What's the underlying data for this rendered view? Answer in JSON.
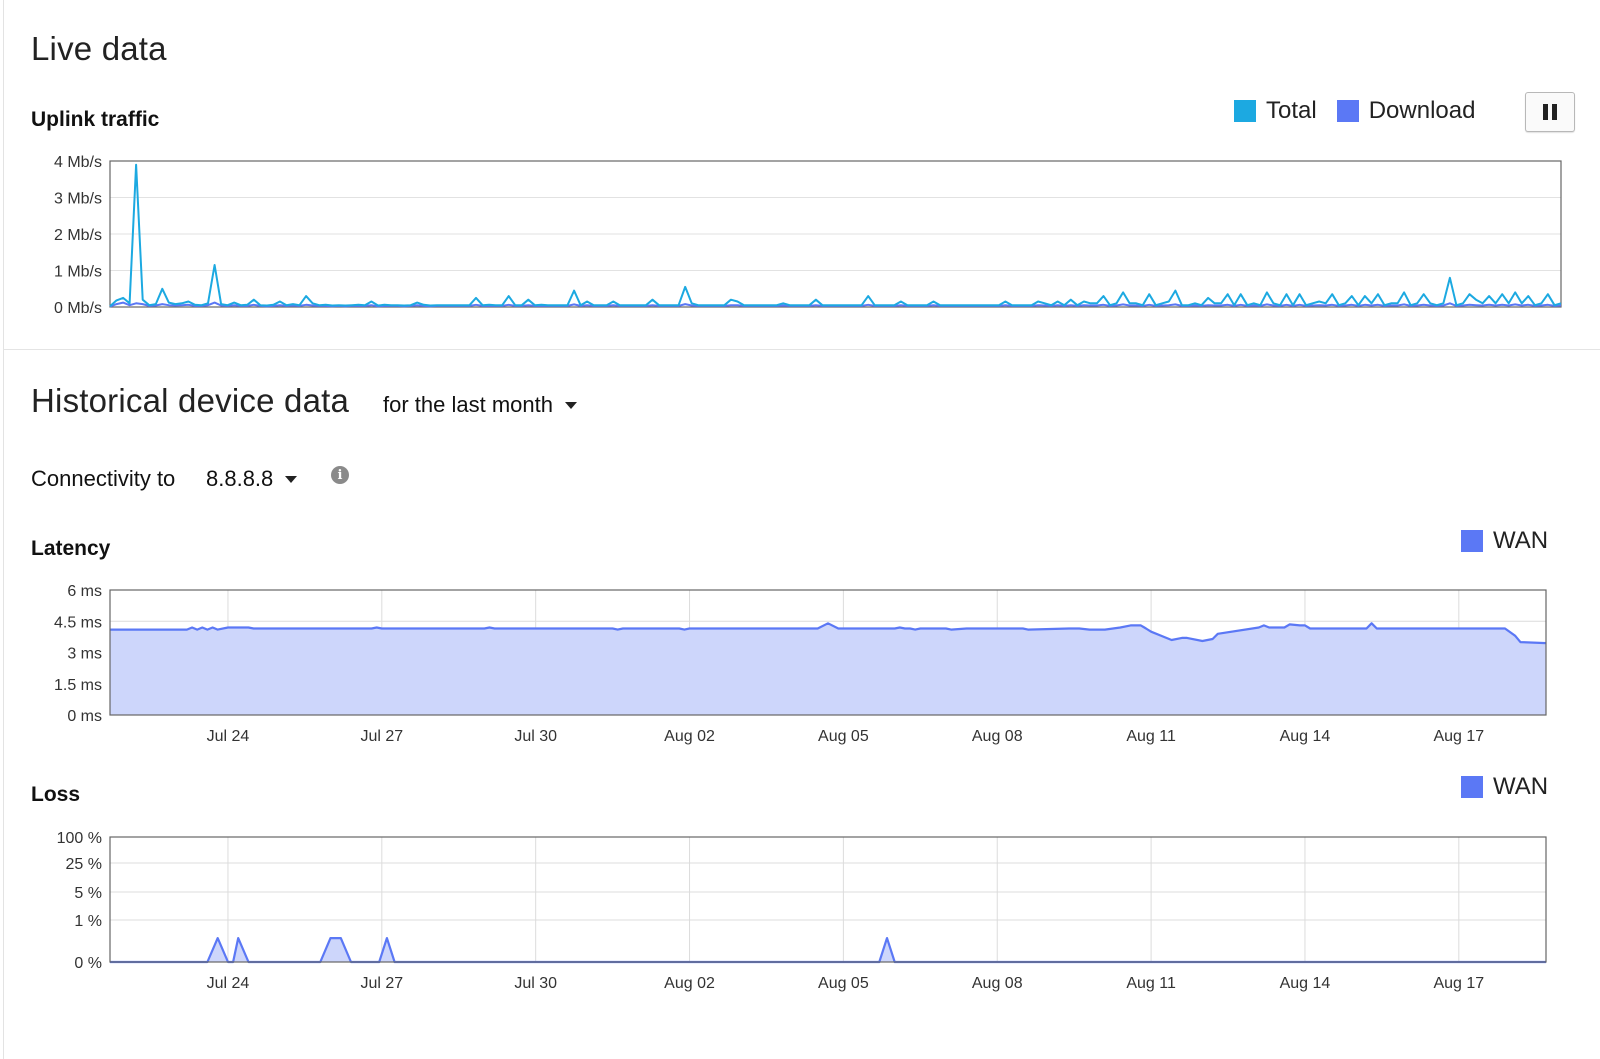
{
  "live": {
    "title": "Live data",
    "uplink_title": "Uplink traffic",
    "legend": [
      {
        "label": "Total",
        "color": "#1ca9e1"
      },
      {
        "label": "Download",
        "color": "#5b78f5"
      }
    ],
    "pause_icon": "pause-icon"
  },
  "historical": {
    "title": "Historical device data",
    "range_label": "for the last month",
    "connectivity_label": "Connectivity to",
    "connectivity_target": "8.8.8.8",
    "info_icon": "i",
    "latency_title": "Latency",
    "loss_title": "Loss",
    "latency_legend": "WAN",
    "loss_legend": "WAN",
    "wan_color": "#5b78f5"
  },
  "chart_data": [
    {
      "id": "uplink",
      "type": "line",
      "title": "Uplink traffic",
      "ylim": [
        0,
        4
      ],
      "yticks": [
        "0 Mb/s",
        "1 Mb/s",
        "2 Mb/s",
        "3 Mb/s",
        "4 Mb/s"
      ],
      "grid": true,
      "legend_position": "top-right",
      "series": [
        {
          "name": "Total",
          "color": "#1ca9e1",
          "values": [
            0.02,
            0.18,
            0.25,
            0.1,
            3.9,
            0.2,
            0.05,
            0.08,
            0.5,
            0.12,
            0.08,
            0.1,
            0.15,
            0.06,
            0.05,
            0.1,
            1.15,
            0.08,
            0.05,
            0.12,
            0.05,
            0.06,
            0.2,
            0.05,
            0.04,
            0.06,
            0.15,
            0.05,
            0.08,
            0.05,
            0.3,
            0.1,
            0.05,
            0.06,
            0.04,
            0.05,
            0.04,
            0.05,
            0.06,
            0.05,
            0.15,
            0.04,
            0.06,
            0.05,
            0.05,
            0.04,
            0.05,
            0.12,
            0.06,
            0.04,
            0.05,
            0.05,
            0.05,
            0.05,
            0.05,
            0.05,
            0.25,
            0.05,
            0.06,
            0.05,
            0.05,
            0.3,
            0.05,
            0.05,
            0.2,
            0.05,
            0.06,
            0.05,
            0.05,
            0.05,
            0.05,
            0.45,
            0.05,
            0.15,
            0.05,
            0.05,
            0.05,
            0.15,
            0.05,
            0.05,
            0.05,
            0.05,
            0.05,
            0.2,
            0.05,
            0.05,
            0.05,
            0.05,
            0.55,
            0.1,
            0.05,
            0.05,
            0.05,
            0.05,
            0.05,
            0.2,
            0.15,
            0.05,
            0.05,
            0.05,
            0.05,
            0.05,
            0.05,
            0.1,
            0.05,
            0.05,
            0.05,
            0.05,
            0.2,
            0.05,
            0.05,
            0.05,
            0.05,
            0.05,
            0.05,
            0.05,
            0.3,
            0.05,
            0.05,
            0.05,
            0.05,
            0.15,
            0.05,
            0.05,
            0.05,
            0.05,
            0.15,
            0.05,
            0.05,
            0.05,
            0.05,
            0.05,
            0.05,
            0.05,
            0.05,
            0.05,
            0.05,
            0.15,
            0.05,
            0.05,
            0.05,
            0.05,
            0.15,
            0.1,
            0.05,
            0.15,
            0.05,
            0.2,
            0.05,
            0.15,
            0.1,
            0.1,
            0.3,
            0.05,
            0.1,
            0.4,
            0.1,
            0.1,
            0.05,
            0.35,
            0.05,
            0.1,
            0.15,
            0.45,
            0.05,
            0.05,
            0.1,
            0.05,
            0.25,
            0.1,
            0.1,
            0.35,
            0.05,
            0.35,
            0.05,
            0.1,
            0.05,
            0.4,
            0.1,
            0.05,
            0.35,
            0.05,
            0.35,
            0.05,
            0.1,
            0.15,
            0.1,
            0.35,
            0.05,
            0.1,
            0.3,
            0.05,
            0.3,
            0.1,
            0.35,
            0.05,
            0.1,
            0.1,
            0.4,
            0.05,
            0.1,
            0.35,
            0.1,
            0.05,
            0.1,
            0.8,
            0.05,
            0.1,
            0.35,
            0.2,
            0.1,
            0.3,
            0.1,
            0.35,
            0.1,
            0.4,
            0.1,
            0.3,
            0.05,
            0.1,
            0.35,
            0.05,
            0.1
          ]
        },
        {
          "name": "Download",
          "color": "#5b78f5",
          "values": [
            0.01,
            0.08,
            0.12,
            0.05,
            0.1,
            0.08,
            0.03,
            0.04,
            0.08,
            0.05,
            0.04,
            0.05,
            0.06,
            0.03,
            0.03,
            0.05,
            0.12,
            0.04,
            0.03,
            0.05,
            0.03,
            0.03,
            0.06,
            0.03,
            0.02,
            0.03,
            0.05,
            0.03,
            0.04,
            0.03,
            0.06,
            0.04,
            0.03,
            0.03,
            0.02,
            0.03,
            0.02,
            0.03,
            0.03,
            0.03,
            0.05,
            0.02,
            0.03,
            0.03,
            0.03,
            0.02,
            0.03,
            0.05,
            0.03,
            0.02,
            0.03,
            0.03,
            0.03,
            0.03,
            0.03,
            0.03,
            0.06,
            0.03,
            0.03,
            0.03,
            0.03,
            0.06,
            0.03,
            0.03,
            0.05,
            0.03,
            0.03,
            0.03,
            0.03,
            0.03,
            0.03,
            0.07,
            0.03,
            0.05,
            0.03,
            0.03,
            0.03,
            0.05,
            0.03,
            0.03,
            0.03,
            0.03,
            0.03,
            0.05,
            0.03,
            0.03,
            0.03,
            0.03,
            0.08,
            0.04,
            0.03,
            0.03,
            0.03,
            0.03,
            0.03,
            0.05,
            0.05,
            0.03,
            0.03,
            0.03,
            0.03,
            0.03,
            0.03,
            0.04,
            0.03,
            0.03,
            0.03,
            0.03,
            0.05,
            0.03,
            0.03,
            0.03,
            0.03,
            0.03,
            0.03,
            0.03,
            0.06,
            0.03,
            0.03,
            0.03,
            0.03,
            0.05,
            0.03,
            0.03,
            0.03,
            0.03,
            0.05,
            0.03,
            0.03,
            0.03,
            0.03,
            0.03,
            0.03,
            0.03,
            0.03,
            0.03,
            0.03,
            0.05,
            0.03,
            0.03,
            0.03,
            0.03,
            0.05,
            0.04,
            0.03,
            0.05,
            0.03,
            0.05,
            0.03,
            0.05,
            0.04,
            0.04,
            0.06,
            0.03,
            0.04,
            0.07,
            0.04,
            0.04,
            0.03,
            0.06,
            0.03,
            0.04,
            0.05,
            0.07,
            0.03,
            0.03,
            0.04,
            0.03,
            0.05,
            0.04,
            0.04,
            0.06,
            0.03,
            0.06,
            0.03,
            0.04,
            0.03,
            0.07,
            0.04,
            0.03,
            0.06,
            0.03,
            0.06,
            0.03,
            0.04,
            0.05,
            0.04,
            0.06,
            0.03,
            0.04,
            0.06,
            0.03,
            0.06,
            0.04,
            0.06,
            0.03,
            0.04,
            0.04,
            0.07,
            0.03,
            0.04,
            0.06,
            0.04,
            0.03,
            0.04,
            0.1,
            0.03,
            0.04,
            0.06,
            0.05,
            0.04,
            0.06,
            0.04,
            0.06,
            0.04,
            0.07,
            0.04,
            0.06,
            0.03,
            0.04,
            0.06,
            0.03,
            0.04
          ]
        }
      ]
    },
    {
      "id": "latency",
      "type": "area",
      "title": "Latency",
      "ylim": [
        0,
        6
      ],
      "yticks": [
        "0 ms",
        "1.5 ms",
        "3 ms",
        "4.5 ms",
        "6 ms"
      ],
      "xticks": [
        "Jul 24",
        "Jul 27",
        "Jul 30",
        "Aug 02",
        "Aug 05",
        "Aug 08",
        "Aug 11",
        "Aug 14",
        "Aug 17"
      ],
      "x_range_days": [
        21.7,
        49.7
      ],
      "grid": true,
      "legend_position": "top-right",
      "series": [
        {
          "name": "WAN",
          "color": "#5b78f5",
          "fill": "#cdd6fb",
          "x": [
            21.7,
            23.2,
            23.3,
            23.4,
            23.5,
            23.6,
            23.7,
            23.8,
            24.0,
            24.4,
            24.5,
            26.8,
            26.9,
            27.0,
            29.0,
            29.1,
            29.2,
            31.5,
            31.6,
            31.7,
            32.8,
            32.9,
            33.0,
            35.5,
            35.7,
            35.9,
            37.0,
            37.1,
            37.2,
            37.3,
            37.4,
            37.5,
            38.0,
            38.1,
            38.4,
            38.5,
            39.5,
            39.6,
            40.4,
            40.6,
            40.8,
            41.1,
            41.4,
            41.6,
            41.8,
            41.9,
            42.0,
            42.4,
            42.6,
            42.7,
            43.0,
            43.2,
            43.3,
            44.1,
            44.2,
            44.3,
            44.6,
            44.7,
            44.9,
            45.0,
            45.1,
            46.2,
            46.3,
            46.4,
            48.9,
            49.1,
            49.2,
            49.7
          ],
          "values": [
            4.1,
            4.1,
            4.2,
            4.1,
            4.2,
            4.1,
            4.2,
            4.1,
            4.2,
            4.2,
            4.15,
            4.15,
            4.2,
            4.15,
            4.15,
            4.2,
            4.15,
            4.15,
            4.1,
            4.15,
            4.15,
            4.1,
            4.15,
            4.15,
            4.4,
            4.15,
            4.15,
            4.2,
            4.15,
            4.15,
            4.1,
            4.15,
            4.15,
            4.1,
            4.15,
            4.15,
            4.15,
            4.1,
            4.15,
            4.15,
            4.1,
            4.1,
            4.2,
            4.3,
            4.3,
            4.15,
            4.0,
            3.6,
            3.7,
            3.7,
            3.55,
            3.65,
            3.9,
            4.2,
            4.3,
            4.2,
            4.2,
            4.35,
            4.3,
            4.3,
            4.15,
            4.15,
            4.4,
            4.15,
            4.15,
            3.8,
            3.5,
            3.45
          ]
        }
      ]
    },
    {
      "id": "loss",
      "type": "area",
      "title": "Loss",
      "yticks": [
        "0 %",
        "1 %",
        "5 %",
        "25 %",
        "100 %"
      ],
      "yscale": "log",
      "xticks": [
        "Jul 24",
        "Jul 27",
        "Jul 30",
        "Aug 02",
        "Aug 05",
        "Aug 08",
        "Aug 11",
        "Aug 14",
        "Aug 17"
      ],
      "x_range_days": [
        21.7,
        49.7
      ],
      "grid": true,
      "legend_position": "top-right",
      "series": [
        {
          "name": "WAN",
          "color": "#5b78f5",
          "fill": "#cdd6fb",
          "x": [
            21.7,
            23.6,
            23.8,
            24.0,
            24.1,
            24.2,
            24.4,
            25.8,
            26.0,
            26.2,
            26.4,
            26.95,
            27.1,
            27.25,
            36.7,
            36.85,
            37.0,
            49.7
          ],
          "values": [
            0,
            0,
            0.5,
            0,
            0,
            0.5,
            0,
            0,
            0.5,
            0.5,
            0,
            0,
            0.5,
            0,
            0,
            0.5,
            0,
            0
          ]
        }
      ]
    }
  ]
}
